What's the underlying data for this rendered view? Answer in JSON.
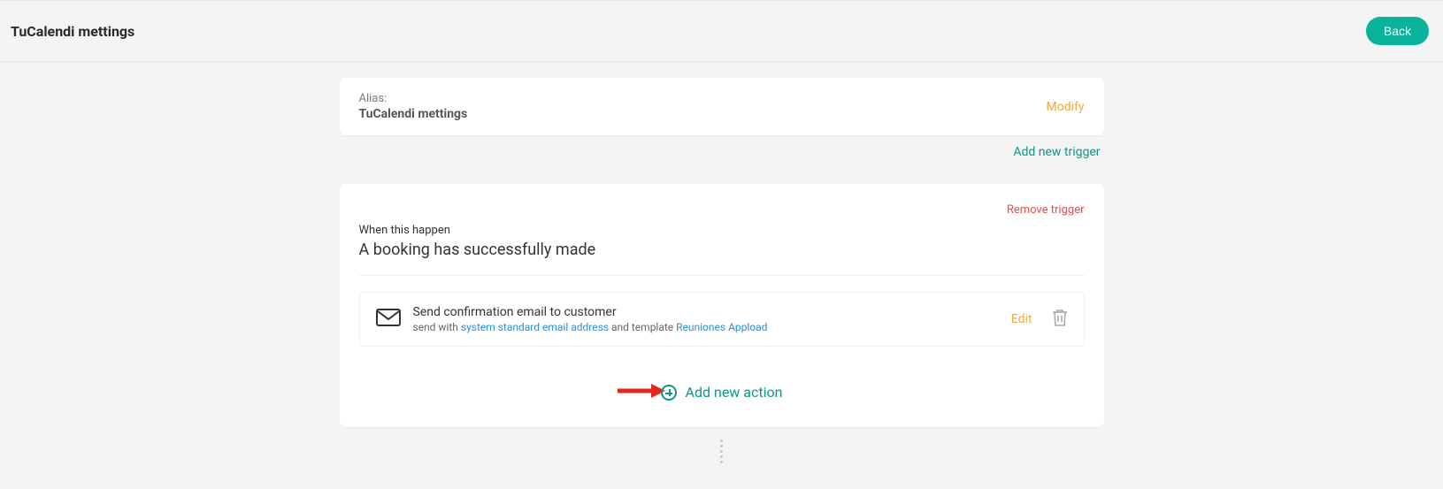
{
  "header": {
    "title": "TuCalendi mettings",
    "back_label": "Back"
  },
  "alias": {
    "label": "Alias:",
    "value": "TuCalendi mettings",
    "modify_label": "Modify"
  },
  "add_trigger_label": "Add new trigger",
  "trigger": {
    "remove_label": "Remove trigger",
    "when_label": "When this happen",
    "when_desc": "A booking has successfully made",
    "actions": [
      {
        "title": "Send confirmation email to customer",
        "sub_prefix": "send with ",
        "sub_link1": "system standard email address",
        "sub_mid": " and template ",
        "sub_link2": "Reuniones Appload",
        "edit_label": "Edit"
      }
    ],
    "add_action_label": "Add new action"
  }
}
